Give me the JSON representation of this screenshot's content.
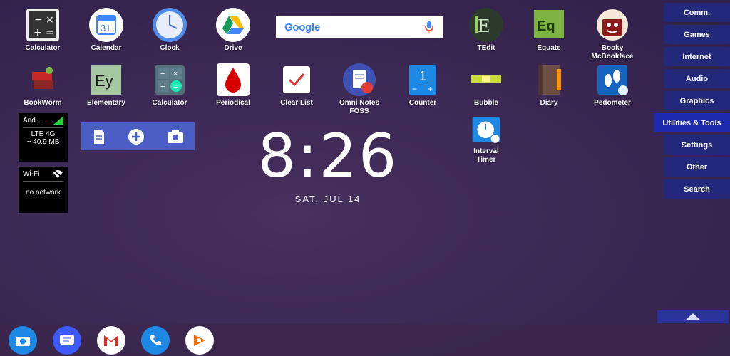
{
  "apps_row1": [
    {
      "label": "Calculator",
      "icon": "calculator-icon"
    },
    {
      "label": "Calendar",
      "icon": "calendar-icon",
      "date": "31"
    },
    {
      "label": "Clock",
      "icon": "clock-icon"
    },
    {
      "label": "Drive",
      "icon": "drive-icon"
    },
    {
      "label": "TEdit",
      "icon": "tedit-icon"
    },
    {
      "label": "Equate",
      "icon": "equate-icon",
      "text": "Eq"
    },
    {
      "label": "Booky\nMcBookface",
      "icon": "booky-icon"
    }
  ],
  "apps_row2": [
    {
      "label": "BookWorm",
      "icon": "bookworm-icon"
    },
    {
      "label": "Elementary",
      "icon": "elementary-icon",
      "text": "Ey"
    },
    {
      "label": "Calculator",
      "icon": "calculator2-icon"
    },
    {
      "label": "Periodical",
      "icon": "periodical-icon"
    },
    {
      "label": "Clear List",
      "icon": "clearlist-icon"
    },
    {
      "label": "Omni Notes\nFOSS",
      "icon": "omninotes-icon"
    },
    {
      "label": "Counter",
      "icon": "counter-icon",
      "text": "1"
    },
    {
      "label": "Bubble",
      "icon": "bubble-level-icon"
    },
    {
      "label": "Diary",
      "icon": "diary-icon"
    },
    {
      "label": "Pedometer",
      "icon": "pedometer-icon"
    }
  ],
  "interval_timer": {
    "label": "Interval\nTimer"
  },
  "search_widget": {
    "logo": "Google"
  },
  "network": {
    "carrier": "And...",
    "type": "LTE 4G",
    "data": "~ 40.9 MB"
  },
  "wifi": {
    "title": "Wi-Fi",
    "status": "no network"
  },
  "clock": {
    "time": "8:26",
    "date": "SAT, JUL 14"
  },
  "categories": [
    "Comm.",
    "Games",
    "Internet",
    "Audio",
    "Graphics",
    "Utilities & Tools",
    "Settings",
    "Other",
    "Search"
  ],
  "active_category": "Utilities & Tools",
  "dock": [
    "camera-icon",
    "messages-icon",
    "gmail-icon",
    "phone-icon",
    "play-music-icon"
  ],
  "colors": {
    "accent": "#1c2ab0",
    "category_bg": "#22297a",
    "quick_widget": "#4a5ec6"
  }
}
